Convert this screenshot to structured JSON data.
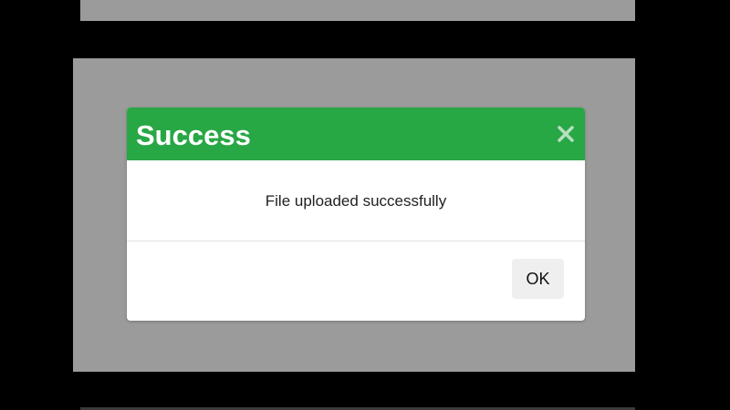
{
  "dialog": {
    "title": "Success",
    "close_icon": "close-icon",
    "message": "File uploaded successfully",
    "ok_label": "OK"
  },
  "colors": {
    "header_bg": "#28a745",
    "backdrop": "#9b9b9b",
    "letterbox": "#000000",
    "dialog_bg": "#ffffff",
    "button_bg": "#efefef"
  }
}
